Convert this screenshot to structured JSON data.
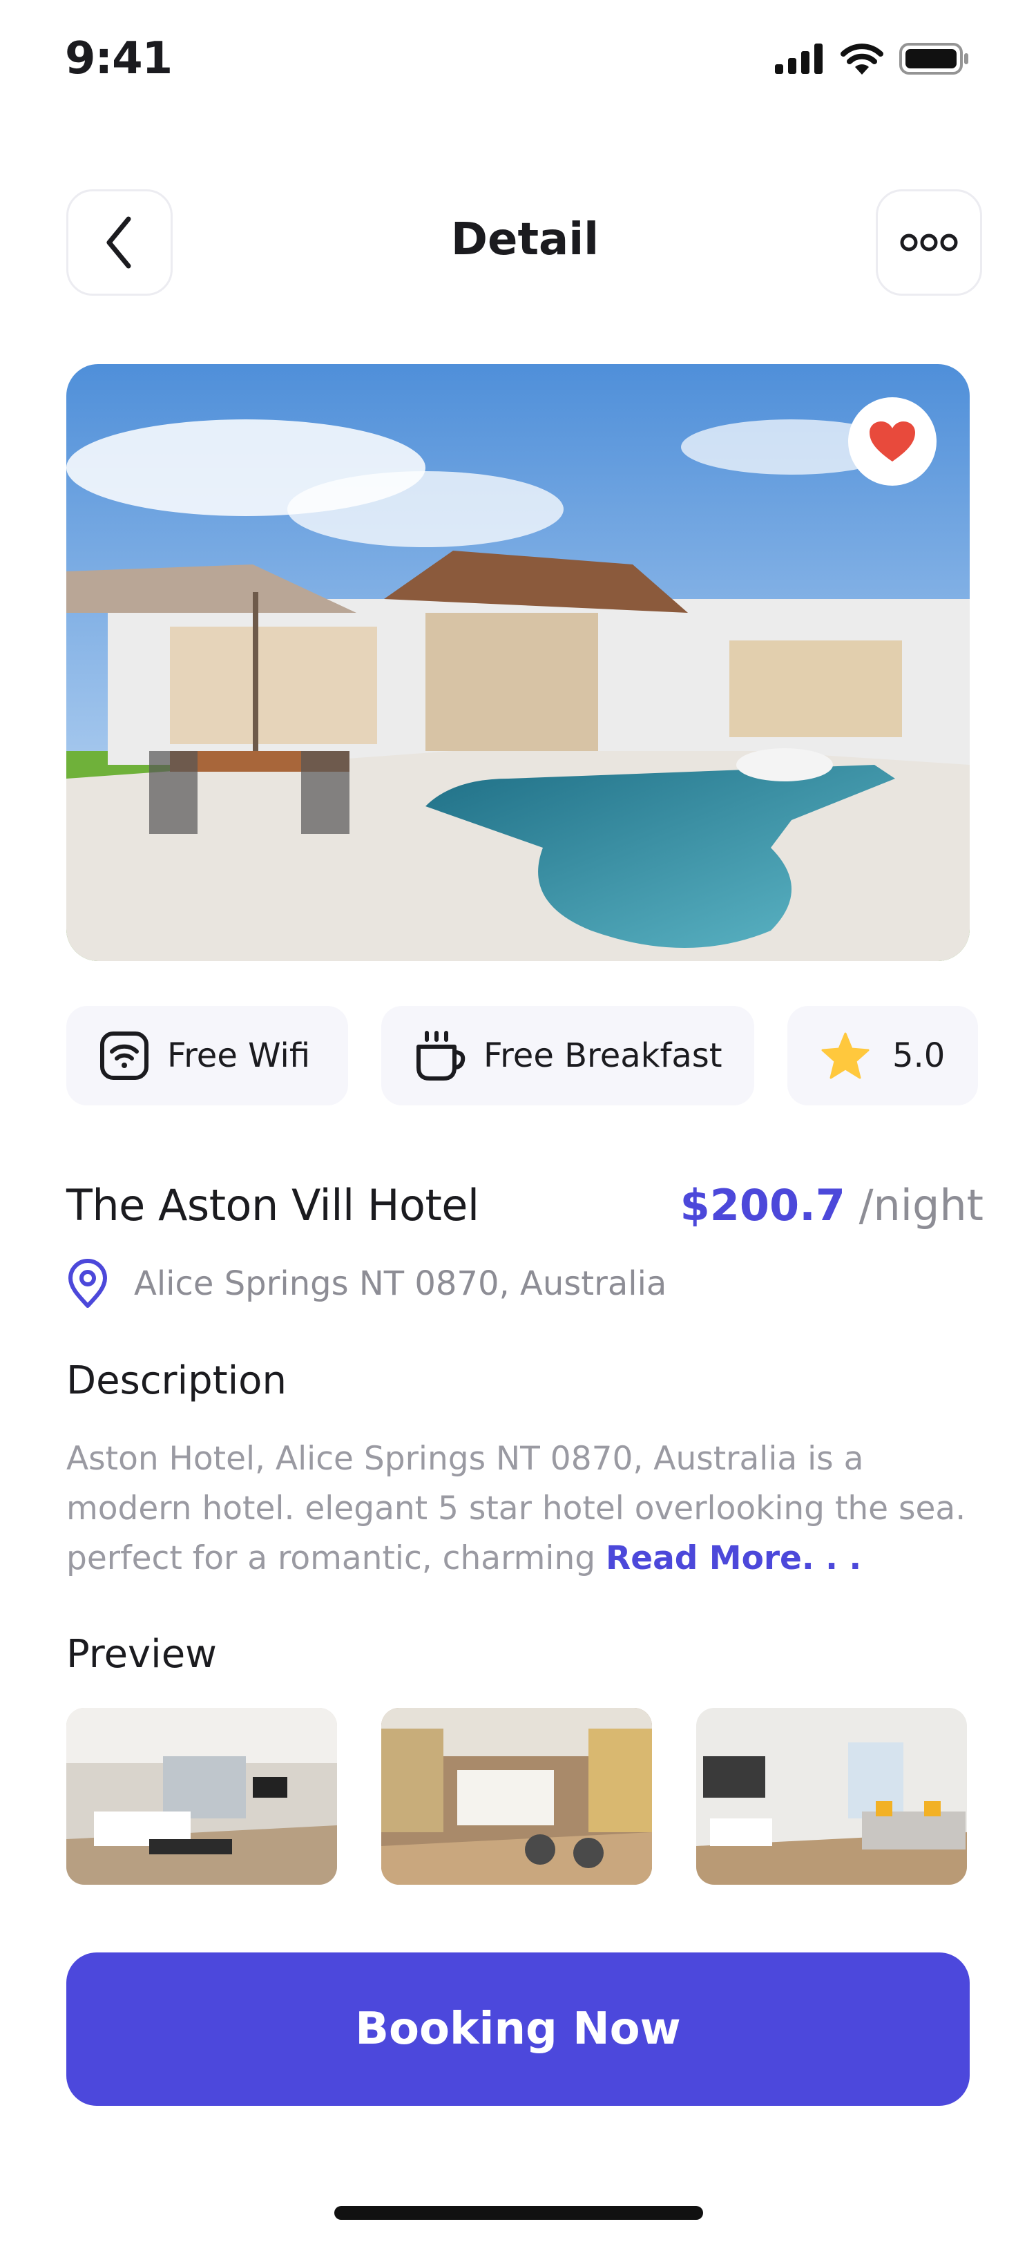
{
  "status_bar": {
    "time": "9:41",
    "icons": [
      "signal-icon",
      "wifi-icon",
      "battery-icon"
    ]
  },
  "header": {
    "title": "Detail",
    "back_icon": "chevron-left-icon",
    "more_icon": "more-dots-icon"
  },
  "hero": {
    "image": "villa-pool-photo",
    "favorite_icon": "heart-icon",
    "favorited": true
  },
  "amenities": [
    {
      "label": "Free Wifi",
      "icon": "wifi-icon"
    },
    {
      "label": "Free Breakfast",
      "icon": "coffee-cup-icon"
    },
    {
      "label": "5.0",
      "icon": "star-icon"
    }
  ],
  "hotel": {
    "name": "The Aston Vill Hotel",
    "price": "$200.7",
    "price_unit": "/night",
    "location": "Alice Springs NT 0870, Australia"
  },
  "description": {
    "title": "Description",
    "text": "Aston Hotel, Alice Springs NT 0870, Australia is a modern hotel. elegant 5 star hotel overlooking the sea. perfect for a romantic, charming ",
    "read_more": "Read More. . ."
  },
  "preview": {
    "title": "Preview",
    "images": [
      "bedroom-photo",
      "lobby-photo",
      "living-room-photo"
    ]
  },
  "booking_button": "Booking Now",
  "colors": {
    "accent": "#4C48DC",
    "muted": "#8D8D95",
    "chip_bg": "#F6F6FB",
    "heart": "#E84A3C",
    "star": "#FFC83D"
  }
}
